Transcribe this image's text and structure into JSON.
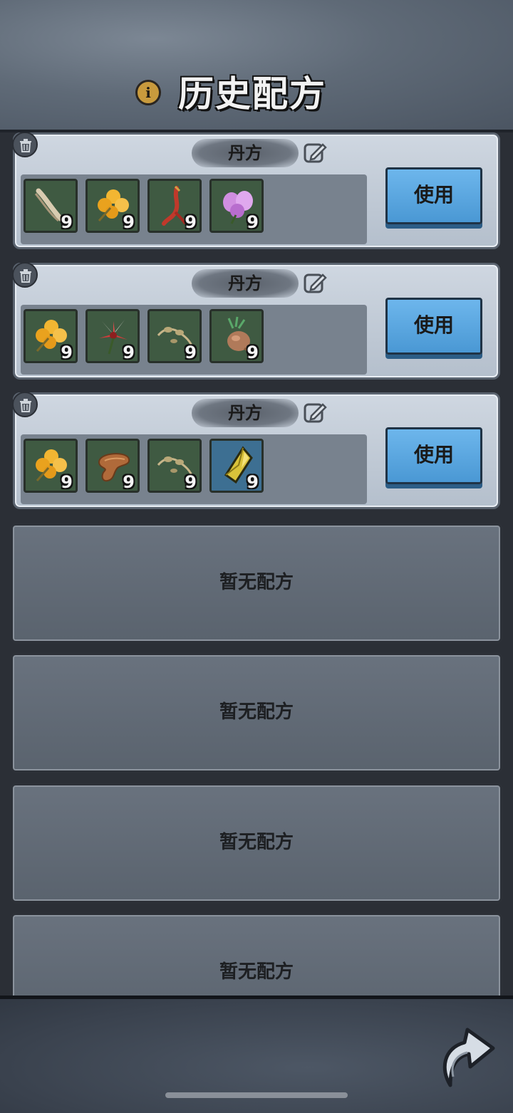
{
  "header": {
    "title": "历史配方"
  },
  "recipes": [
    {
      "name": "丹方",
      "use_label": "使用",
      "items": [
        {
          "icon": "bone-herb-icon",
          "qty": "9"
        },
        {
          "icon": "golden-flower-icon",
          "qty": "9"
        },
        {
          "icon": "red-root-icon",
          "qty": "9"
        },
        {
          "icon": "purple-flower-icon",
          "qty": "9"
        }
      ]
    },
    {
      "name": "丹方",
      "use_label": "使用",
      "items": [
        {
          "icon": "golden-flower-icon",
          "qty": "9"
        },
        {
          "icon": "red-lily-icon",
          "qty": "9"
        },
        {
          "icon": "vine-herb-icon",
          "qty": "9"
        },
        {
          "icon": "root-bulb-icon",
          "qty": "9"
        }
      ]
    },
    {
      "name": "丹方",
      "use_label": "使用",
      "items": [
        {
          "icon": "golden-flower-icon",
          "qty": "9"
        },
        {
          "icon": "mushroom-icon",
          "qty": "9"
        },
        {
          "icon": "vine-herb-icon",
          "qty": "9"
        },
        {
          "icon": "gold-crystal-icon",
          "qty": "9"
        }
      ]
    }
  ],
  "empty_slots": [
    {
      "label": "暂无配方"
    },
    {
      "label": "暂无配方"
    },
    {
      "label": "暂无配方"
    },
    {
      "label": "暂无配方"
    }
  ],
  "colors": {
    "use_button": "#5aa7e0",
    "item_slot": "#3f5a42",
    "rare_slot": "#3d6f92"
  }
}
